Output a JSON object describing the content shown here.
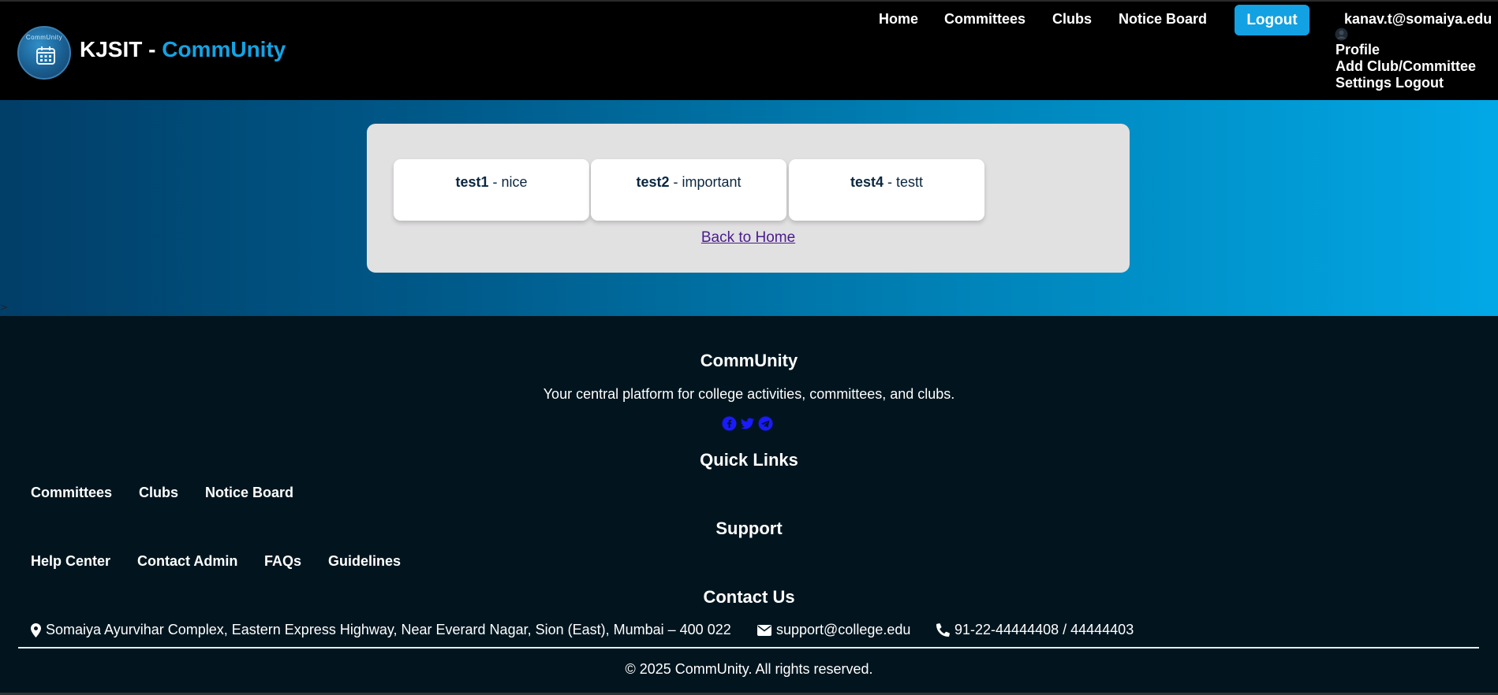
{
  "header": {
    "logo_text": "CommUnity",
    "brand_prefix": "KJSIT - ",
    "brand_accent": "CommUnity",
    "nav": [
      "Home",
      "Committees",
      "Clubs",
      "Notice Board"
    ],
    "logout_label": "Logout",
    "user_email": "kanav.t@somaiya.edu",
    "dropdown": [
      "Profile",
      "Add Club/Committee",
      "Settings Logout"
    ]
  },
  "hero": {
    "stray_mark": ">",
    "cards": [
      {
        "title": "test1",
        "sep": " - ",
        "desc": "nice"
      },
      {
        "title": "test2",
        "sep": " - ",
        "desc": "important"
      },
      {
        "title": "test4",
        "sep": " - ",
        "desc": "testt"
      }
    ],
    "back_link": "Back to Home"
  },
  "footer": {
    "title": "CommUnity",
    "tagline": "Your central platform for college activities, committees, and clubs.",
    "socials": [
      "facebook-icon",
      "twitter-icon",
      "telegram-icon"
    ],
    "quick_links_heading": "Quick Links",
    "quick_links": [
      "Committees",
      "Clubs",
      "Notice Board"
    ],
    "support_heading": "Support",
    "support_links": [
      "Help Center",
      "Contact Admin",
      "FAQs",
      "Guidelines"
    ],
    "contact_heading": "Contact Us",
    "address": "Somaiya Ayurvihar Complex, Eastern Express Highway, Near Everard Nagar, Sion (East), Mumbai – 400 022",
    "email": "support@college.edu",
    "phone": "91-22-44444408 / 44444403",
    "copyright": "© 2025 CommUnity. All rights reserved."
  },
  "colors": {
    "accent": "#14a3e3",
    "header_bg": "#000000",
    "footer_bg": "#02151f",
    "panel_bg": "#e2e1e2",
    "social_icon": "#1a1aff"
  }
}
